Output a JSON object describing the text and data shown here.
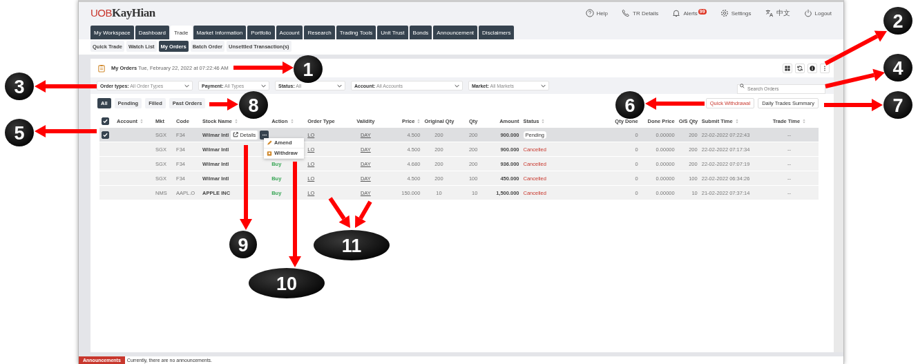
{
  "logo": {
    "part_1": "UOB",
    "part_2": "KayHian"
  },
  "top_nav": [
    {
      "kind": "help",
      "label": "Help"
    },
    {
      "kind": "phone",
      "label": "TR Details"
    },
    {
      "kind": "bell",
      "label": "Alerts",
      "badge": "99"
    },
    {
      "kind": "gear",
      "label": "Settings"
    },
    {
      "kind": "translate",
      "label": "中文"
    },
    {
      "kind": "power",
      "label": "Logout"
    }
  ],
  "tabs": [
    {
      "label": "My Workspace",
      "selected": false
    },
    {
      "label": "Dashboard",
      "selected": false
    },
    {
      "label": "Trade",
      "selected": true
    },
    {
      "label": "Market Information",
      "selected": false
    },
    {
      "label": "Portfolio",
      "selected": false
    },
    {
      "label": "Account",
      "selected": false
    },
    {
      "label": "Research",
      "selected": false
    },
    {
      "label": "Trading Tools",
      "selected": false
    },
    {
      "label": "Unit Trust",
      "selected": false
    },
    {
      "label": "Bonds",
      "selected": false
    },
    {
      "label": "Announcement",
      "selected": false
    },
    {
      "label": "Disclaimers",
      "selected": false
    }
  ],
  "subtabs": [
    {
      "label": "Quick Trade",
      "selected": false
    },
    {
      "label": "Watch List",
      "selected": false
    },
    {
      "label": "My Orders",
      "selected": true
    },
    {
      "label": "Batch Order",
      "selected": false
    },
    {
      "label": "Unsettled Transaction(s)",
      "selected": false
    }
  ],
  "panel": {
    "title": "My Orders",
    "timestamp": "Tue, February 22, 2022 at 07:22:46 AM"
  },
  "filters": [
    {
      "label": "Order types:",
      "value": "All Order Types"
    },
    {
      "label": "Payment:",
      "value": "All Types"
    },
    {
      "label": "Status:",
      "value": "All"
    },
    {
      "label": "Account:",
      "value": "All Accounts"
    },
    {
      "label": "Market:",
      "value": "All Markets"
    }
  ],
  "search": {
    "placeholder": "Search Orders"
  },
  "status_filters": [
    {
      "label": "All",
      "selected": true
    },
    {
      "label": "Pending",
      "selected": false
    },
    {
      "label": "Filled",
      "selected": false
    },
    {
      "label": "Past Orders",
      "selected": false
    }
  ],
  "action_buttons": [
    {
      "kind": "danger",
      "label": "Quick Withdrawal"
    },
    {
      "kind": "plain",
      "label": "Daily Trades Summary"
    }
  ],
  "table": {
    "select_all_checked": true,
    "columns": [
      {
        "label": "Account",
        "sortable": true
      },
      {
        "label": "Mkt",
        "sortable": false
      },
      {
        "label": "Code",
        "sortable": false
      },
      {
        "label": "Stock Name",
        "sortable": true
      },
      {
        "label": "Action",
        "sortable": true
      },
      {
        "label": "Order Type",
        "sortable": false
      },
      {
        "label": "Validity",
        "sortable": false
      },
      {
        "label": "Price",
        "sortable": true
      },
      {
        "label": "Original Qty",
        "sortable": false
      },
      {
        "label": "Qty",
        "sortable": false
      },
      {
        "label": "Amount",
        "sortable": false
      },
      {
        "label": "Status",
        "sortable": true
      },
      {
        "label": "Qty Done",
        "sortable": false
      },
      {
        "label": "Done Price",
        "sortable": false
      },
      {
        "label": "O/S Qty",
        "sortable": false
      },
      {
        "label": "Submit Time",
        "sortable": true
      },
      {
        "label": "Trade Time",
        "sortable": true
      }
    ],
    "rows": [
      {
        "checked": true,
        "selected": true,
        "mkt": "SGX",
        "code": "F34",
        "stock": "Wilmar Intl",
        "order_type": "LO",
        "validity": "DAY",
        "price": "4.500",
        "original_qty": "200",
        "qty": "200",
        "amount": "900.000",
        "status": {
          "kind": "pending",
          "label": "Pending"
        },
        "qty_done": "0",
        "done_price": "0.00000",
        "os_qty": "200",
        "submit_time": "22-02-2022 07:22:43",
        "trade_time": "--"
      },
      {
        "checked": false,
        "selected": false,
        "mkt": "SGX",
        "code": "F34",
        "stock": "Wilmar Intl",
        "order_type": "LO",
        "validity": "DAY",
        "price": "4.500",
        "original_qty": "200",
        "qty": "200",
        "amount": "900.000",
        "status": {
          "kind": "cancelled",
          "label": "Cancelled"
        },
        "qty_done": "0",
        "done_price": "0.00000",
        "os_qty": "200",
        "submit_time": "22-02-2022 07:17:34",
        "trade_time": "--"
      },
      {
        "checked": false,
        "selected": false,
        "mkt": "SGX",
        "code": "F34",
        "stock": "Wilmar Intl",
        "action": "Buy",
        "order_type": "LO",
        "validity": "DAY",
        "price": "4.680",
        "original_qty": "200",
        "qty": "200",
        "amount": "936.000",
        "status": {
          "kind": "cancelled",
          "label": "Cancelled"
        },
        "qty_done": "0",
        "done_price": "0.00000",
        "os_qty": "200",
        "submit_time": "22-02-2022 07:07:19",
        "trade_time": "--"
      },
      {
        "checked": false,
        "selected": false,
        "mkt": "SGX",
        "code": "F34",
        "stock": "Wilmar Intl",
        "action": "Buy",
        "order_type": "LO",
        "validity": "DAY",
        "price": "4.500",
        "original_qty": "200",
        "qty": "100",
        "amount": "450.000",
        "status": {
          "kind": "cancelled",
          "label": "Cancelled"
        },
        "qty_done": "0",
        "done_price": "0.00000",
        "os_qty": "100",
        "submit_time": "22-02-2022 06:34:26",
        "trade_time": "--"
      },
      {
        "checked": false,
        "selected": false,
        "mkt": "NMS",
        "code": "AAPL.O",
        "stock": "APPLE INC",
        "action": "Buy",
        "order_type": "LO",
        "validity": "DAY",
        "price": "150.000",
        "original_qty": "10",
        "qty": "10",
        "amount": "1,500.000",
        "status": {
          "kind": "cancelled",
          "label": "Cancelled"
        },
        "qty_done": "0",
        "done_price": "0.00000",
        "os_qty": "10",
        "submit_time": "21-02-2022 07:37:14",
        "trade_time": "--"
      }
    ],
    "row_details_button": "Details",
    "row_menu": [
      {
        "kind": "pencil",
        "label": "Amend"
      },
      {
        "kind": "withdraw",
        "label": "Withdraw"
      }
    ]
  },
  "announcements": {
    "label": "Announcements",
    "text": "Currently, there are no announcements."
  },
  "callouts": [
    {
      "label": "2"
    },
    {
      "label": "1"
    },
    {
      "label": "4"
    },
    {
      "label": "3"
    },
    {
      "label": "8"
    },
    {
      "label": "6"
    },
    {
      "label": "7"
    },
    {
      "label": "5"
    },
    {
      "label": "9"
    },
    {
      "label": "11"
    },
    {
      "label": "10"
    }
  ]
}
